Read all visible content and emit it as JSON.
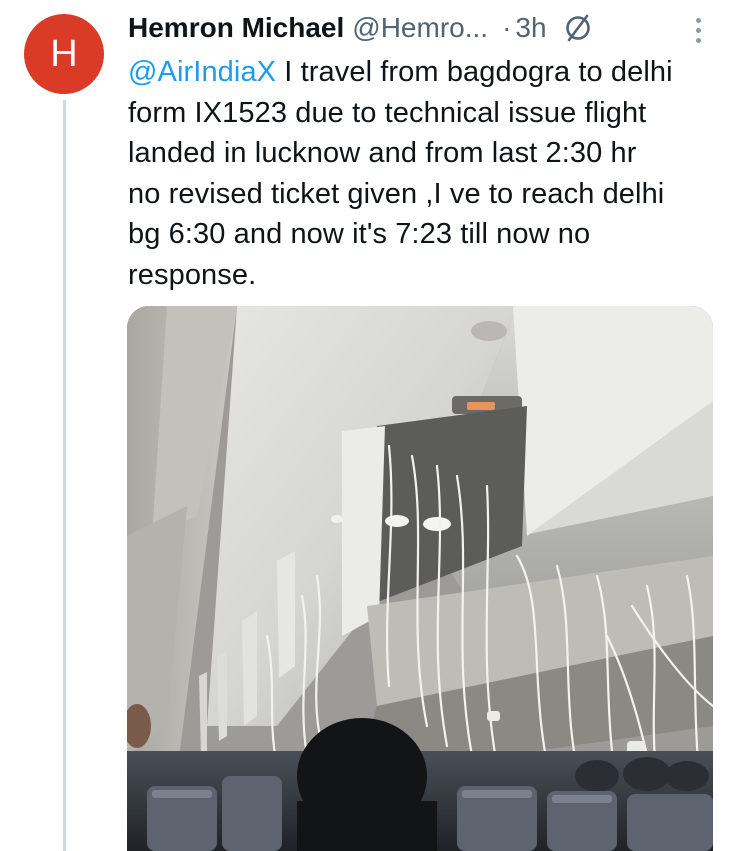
{
  "tweet": {
    "avatar_letter": "H",
    "avatar_color": "#d93b26",
    "display_name": "Hemron Michael",
    "handle": "@Hemro...",
    "dot": "·",
    "time": "3h",
    "status_icon": "slashed-circle-icon",
    "more_icon": "vertical-ellipsis-icon",
    "mention": "@AirIndiaX",
    "body_lines": [
      " I travel from bagdogra to delhi",
      "form IX1523 due to technical issue flight",
      "landed in lucknow and from last 2:30 hr",
      "no revised ticket given ,I ve to reach delhi",
      "bg 6:30 and now it's 7:23 till now no",
      "response."
    ],
    "media_description_icon": "photo-aircraft-cabin-oxygen-masks",
    "colors": {
      "mention": "#1d9bf0",
      "secondary_text": "#536471",
      "thread_line": "#cfd9de"
    }
  }
}
